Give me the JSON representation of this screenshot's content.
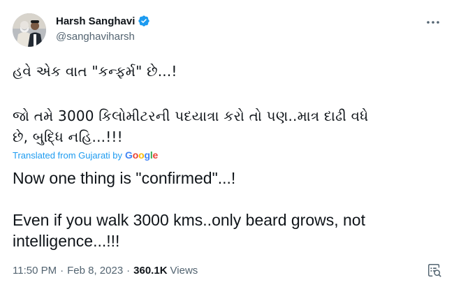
{
  "author": {
    "display_name": "Harsh Sanghavi",
    "handle": "@sanghaviharsh",
    "verified_icon": "verified-badge-icon",
    "avatar_icon": "avatar-photo",
    "accent_color": "#1d9bf0"
  },
  "more_icon": "more-dots-icon",
  "original_text": {
    "line1": "હવે એક વાત \"કન્ફર્મ\" છે...!",
    "line2": "જો તમે 3000 કિલોમીટરની પદયાત્રા કરો તો પણ..માત્ર દાઢી વધે",
    "line3": "છે, બુદ્ધિ નહિ...!!!"
  },
  "translation_label": {
    "prefix": "Translated from Gujarati by",
    "provider_letters": [
      "G",
      "o",
      "o",
      "g",
      "l",
      "e"
    ]
  },
  "translated_text": {
    "line1": "Now one thing is \"confirmed\"...!",
    "line2": "Even if you walk 3000 kms..only beard grows, not",
    "line3": "intelligence...!!!"
  },
  "meta": {
    "time": "11:50 PM",
    "separator": "·",
    "date": "Feb 8, 2023",
    "views_count": "360.1K",
    "views_label": "Views"
  },
  "analytics_icon": "analytics-icon"
}
